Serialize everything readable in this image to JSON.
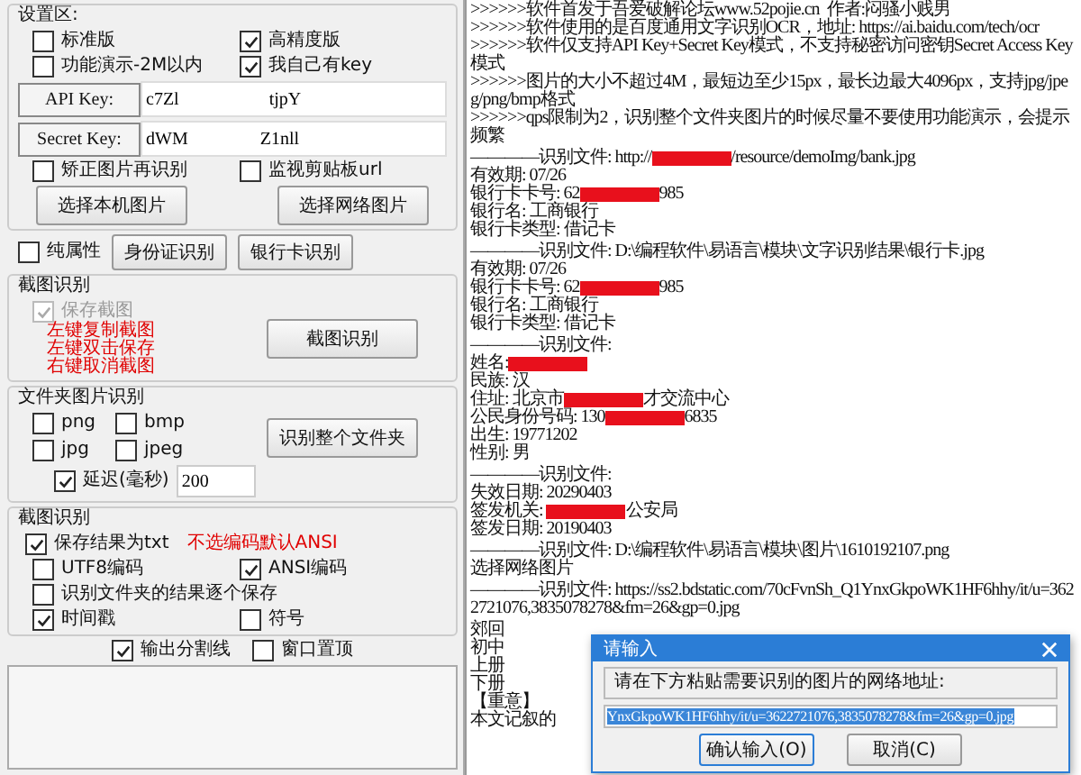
{
  "settings": {
    "title": "设置区:",
    "checkboxes": [
      {
        "label": "标准版",
        "checked": false
      },
      {
        "label": "高精度版",
        "checked": true
      },
      {
        "label": "功能演示-2M以内",
        "checked": false
      },
      {
        "label": "我自己有key",
        "checked": true
      }
    ],
    "api_key": {
      "label": "API Key:",
      "value": "c7Zl                    tjpY"
    },
    "secret_key": {
      "label": "Secret Key:",
      "value": "dWM                Z1nll"
    },
    "options": [
      {
        "label": "矫正图片再识别",
        "checked": false
      },
      {
        "label": "监视剪贴板url",
        "checked": false
      }
    ],
    "buttons": [
      "选择本机图片",
      "选择网络图片"
    ],
    "pure_attr": {
      "label": "纯属性",
      "checked": false
    },
    "id_buttons": [
      "身份证识别",
      "银行卡识别"
    ]
  },
  "screenshot": {
    "title": "截图识别",
    "save": {
      "label": "保存截图",
      "checked": true,
      "disabled": true
    },
    "hints": [
      "左键复制截图",
      "左键双击保存",
      "右键取消截图"
    ],
    "button": "截图识别"
  },
  "folder": {
    "title": "文件夹图片识别",
    "formats": [
      {
        "label": "png",
        "checked": false
      },
      {
        "label": "bmp",
        "checked": false
      },
      {
        "label": "jpg",
        "checked": false
      },
      {
        "label": "jpeg",
        "checked": false
      }
    ],
    "button": "识别整个文件夹",
    "delay": {
      "label": "延迟(毫秒)",
      "checked": true,
      "value": "200"
    }
  },
  "output_settings": {
    "title": "截图识别",
    "save_txt": {
      "label": "保存结果为txt",
      "checked": true
    },
    "note": "不选编码默认ANSI",
    "options": [
      {
        "label": "UTF8编码",
        "checked": false
      },
      {
        "label": "ANSI编码",
        "checked": true
      },
      {
        "label": "识别文件夹的结果逐个保存",
        "checked": false
      },
      {
        "label": "时间戳",
        "checked": true
      },
      {
        "label": "符号",
        "checked": false
      }
    ]
  },
  "bottom_options": [
    {
      "label": "输出分割线",
      "checked": true
    },
    {
      "label": "窗口置顶",
      "checked": false
    }
  ],
  "output": [
    {
      "kind": "text",
      "text": ">>>>>>软件首发于吾爱破解论坛www.52pojie.cn  作者:闷骚小贱男"
    },
    {
      "kind": "text",
      "text": ">>>>>>软件使用的是百度通用文字识别OCR，地址: https://ai.baidu.com/tech/ocr"
    },
    {
      "kind": "text",
      "text": ">>>>>>软件仅支持API Key+Secret Key模式，不支持秘密访问密钥Secret Access Key模式"
    },
    {
      "kind": "text",
      "text": ">>>>>>图片的大小不超过4M，最短边至少15px，最长边最大4096px，支持jpg/jpeg/png/bmp格式"
    },
    {
      "kind": "text",
      "text": ">>>>>>qps限制为2，识别整个文件夹图片的时候尽量不要使用功能演示，会提示频繁"
    },
    {
      "kind": "blank"
    },
    {
      "kind": "masked",
      "before": "————识别文件: http://",
      "after": "/resource/demoImg/bank.jpg"
    },
    {
      "kind": "text",
      "text": "有效期: 07/26"
    },
    {
      "kind": "masked",
      "before": "银行卡卡号: 62",
      "after": "985"
    },
    {
      "kind": "text",
      "text": "银行名: 工商银行"
    },
    {
      "kind": "text",
      "text": "银行卡类型: 借记卡"
    },
    {
      "kind": "blank"
    },
    {
      "kind": "text",
      "text": "————识别文件: D:\\编程软件\\易语言\\模块\\文字识别结果\\银行卡.jpg"
    },
    {
      "kind": "text",
      "text": "有效期: 07/26"
    },
    {
      "kind": "masked",
      "before": "银行卡卡号: 62",
      "after": "985"
    },
    {
      "kind": "text",
      "text": "银行名: 工商银行"
    },
    {
      "kind": "text",
      "text": "银行卡类型: 借记卡"
    },
    {
      "kind": "blank"
    },
    {
      "kind": "text",
      "text": "————识别文件:"
    },
    {
      "kind": "masked",
      "before": "姓名:"
    },
    {
      "kind": "text",
      "text": "民族: 汉"
    },
    {
      "kind": "masked",
      "before": "住址: 北京市",
      "after": "才交流中心"
    },
    {
      "kind": "masked",
      "before": "公民身份号码: 130",
      "after": "6835"
    },
    {
      "kind": "text",
      "text": "出生: 19771202"
    },
    {
      "kind": "text",
      "text": "性别: 男"
    },
    {
      "kind": "blank"
    },
    {
      "kind": "text",
      "text": "————识别文件:"
    },
    {
      "kind": "text",
      "text": "失效日期: 20290403"
    },
    {
      "kind": "masked",
      "before": "签发机关: ",
      "after": "公安局"
    },
    {
      "kind": "text",
      "text": "签发日期: 20190403"
    },
    {
      "kind": "blank"
    },
    {
      "kind": "text",
      "text": "————识别文件: D:\\编程软件\\易语言\\模块\\图片\\1610192107.png"
    },
    {
      "kind": "text",
      "text": "选择网络图片"
    },
    {
      "kind": "blank"
    },
    {
      "kind": "text",
      "text": "————识别文件: https://ss2.bdstatic.com/70cFvnSh_Q1YnxGkpoWK1HF6hhy/it/u=3622721076,3835078278&fm=26&gp=0.jpg"
    },
    {
      "kind": "blank"
    },
    {
      "kind": "short",
      "text": "郊回"
    },
    {
      "kind": "short",
      "text": "初中"
    },
    {
      "kind": "short",
      "text": "上册"
    },
    {
      "kind": "short",
      "text": "下册"
    },
    {
      "kind": "short",
      "text": "【重意】"
    },
    {
      "kind": "short",
      "text": "本文记叙的"
    }
  ],
  "dialog": {
    "title": "请输入",
    "prompt": "请在下方粘贴需要识别的图片的网络地址:",
    "value": "YnxGkpoWK1HF6hhy/it/u=3622721076,3835078278&fm=26&gp=0.jpg",
    "buttons": [
      "确认输入(O)",
      "取消(C)"
    ]
  }
}
